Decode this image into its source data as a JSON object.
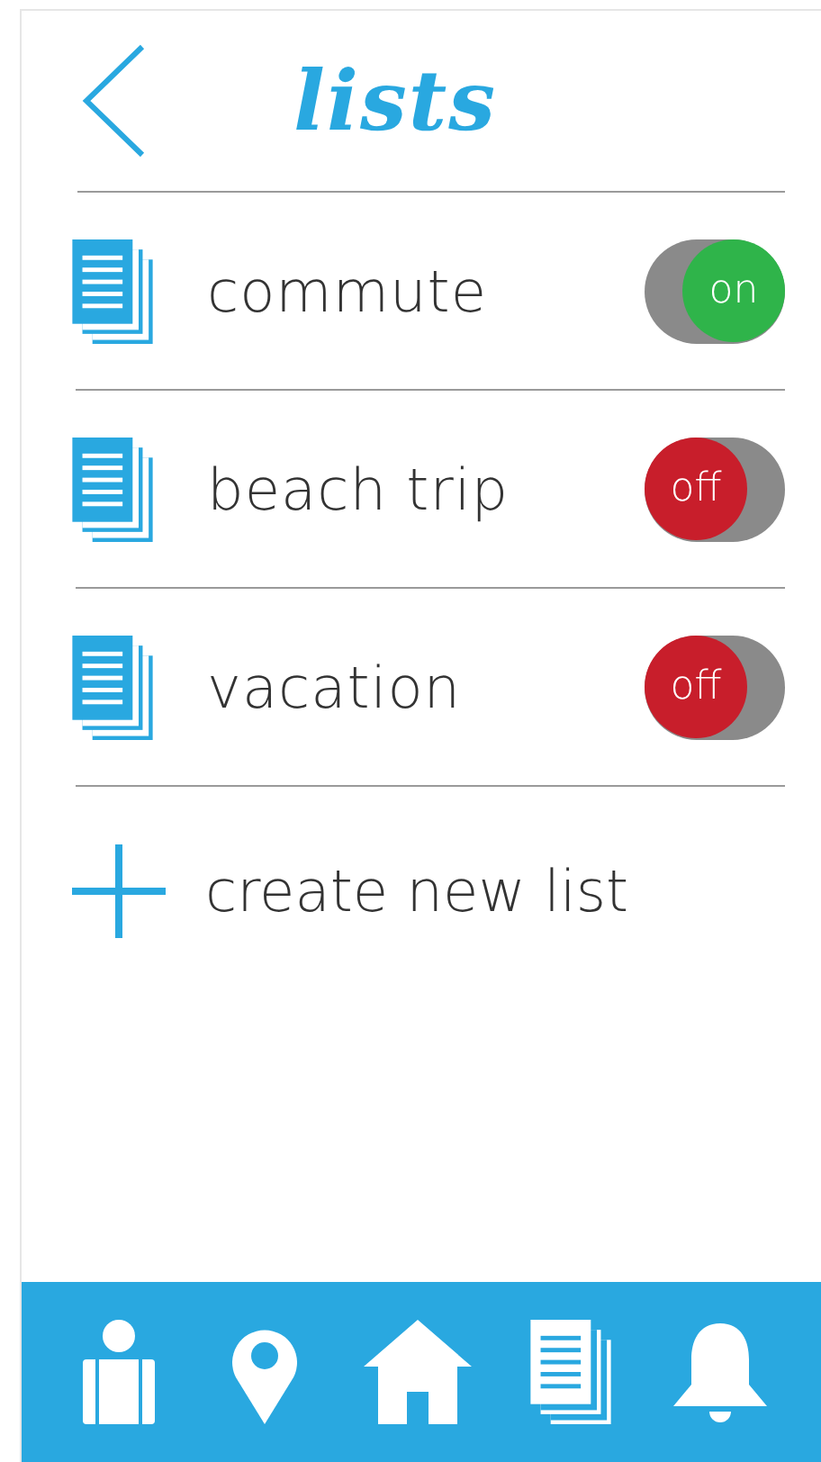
{
  "header": {
    "title": "lists"
  },
  "lists": [
    {
      "name": "commute",
      "on": true,
      "toggle_label": "on"
    },
    {
      "name": "beach trip",
      "on": false,
      "toggle_label": "off"
    },
    {
      "name": "vacation",
      "on": false,
      "toggle_label": "off"
    }
  ],
  "create": {
    "label": "create new list"
  },
  "nav": [
    {
      "kind": "profile"
    },
    {
      "kind": "location"
    },
    {
      "kind": "home"
    },
    {
      "kind": "lists"
    },
    {
      "kind": "notifications"
    }
  ]
}
